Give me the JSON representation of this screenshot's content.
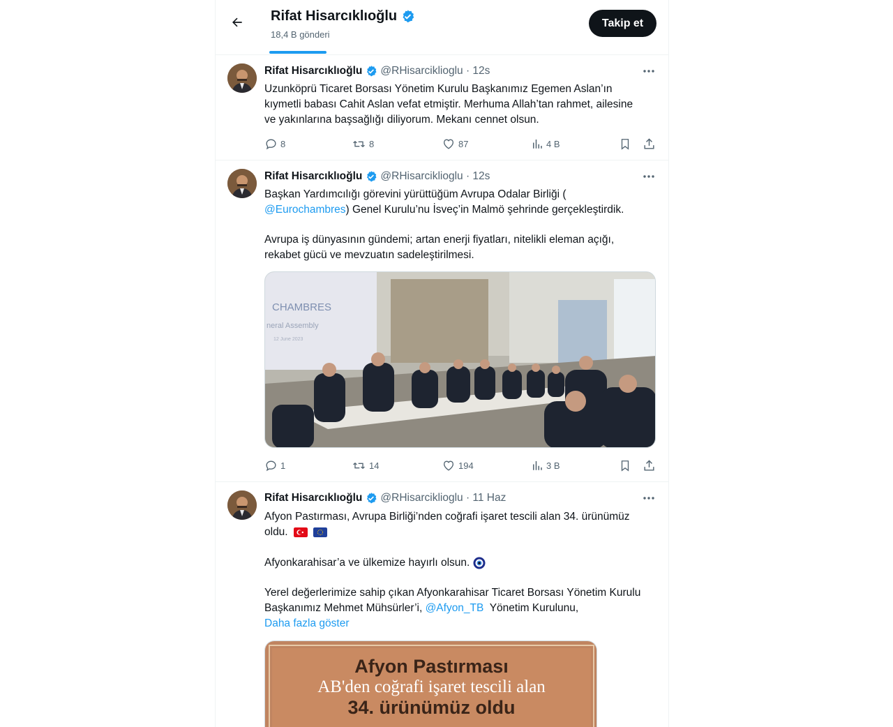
{
  "header": {
    "title": "Rifat Hisarcıklıoğlu",
    "post_count": "18,4 B gönderi",
    "follow_label": "Takip et"
  },
  "tweets": [
    {
      "name": "Rifat Hisarcıklıoğlu",
      "handle_time": "@RHisarciklioglu · 12s",
      "lines": [
        "Uzunköprü Ticaret Borsası Yönetim Kurulu Başkanımız Egemen Aslan’ın",
        "kıymetli babası Cahit Aslan vefat etmiştir. Merhuma Allah’tan rahmet, ailesine",
        "ve yakınlarına başsağlığı diliyorum. Mekanı cennet olsun."
      ],
      "replies": "8",
      "retweets": "8",
      "likes": "87",
      "views": "4 B"
    },
    {
      "name": "Rifat Hisarcıklıoğlu",
      "handle_time": "@RHisarciklioglu · 12s",
      "line1": "Başkan Yardımcılığı görevini yürüttüğüm Avrupa Odalar Birliği (",
      "mention": "@Eurochambres",
      "line2_rest": ") Genel Kurulu’nu İsveç’in Malmö şehrinde gerçekleştirdik.",
      "line3": "Avrupa iş dünyasının gündemi; artan enerji fiyatları, nitelikli eleman açığı,",
      "line4": "rekabet gücü ve mevzuatın sadeleştirilmesi.",
      "banner_text": "CHAMBRES",
      "banner_sub": "neral Assembly",
      "banner_date": "12 June 2023",
      "replies": "1",
      "retweets": "14",
      "likes": "194",
      "views": "3 B"
    },
    {
      "name": "Rifat Hisarcıklıoğlu",
      "handle_time": "@RHisarciklioglu · 11 Haz",
      "line1": "Afyon Pastırması, Avrupa Birliği’nden coğrafi işaret tescili alan 34. ürünümüz",
      "line2": "oldu.",
      "line3": "Afyonkarahisar’a ve ülkemize hayırlı olsun.",
      "line4": "Yerel değerlerimize sahip çıkan Afyonkarahisar Ticaret Borsası Yönetim Kurulu",
      "line5_start": "Başkanımız Mehmet Mühsürler’i, ",
      "mention": "@Afyon_TB",
      "line5_end": "  Yönetim Kurulunu,",
      "show_more": "Daha fazla göster",
      "image_title": "Afyon Pastırması",
      "image_line2": "AB'den coğrafi işaret tescili alan",
      "image_line3": "34. ürünümüz oldu"
    }
  ],
  "colors": {
    "accent": "#1d9bf0",
    "text": "#0f1419",
    "muted": "#536471",
    "border": "#eff3f4"
  }
}
